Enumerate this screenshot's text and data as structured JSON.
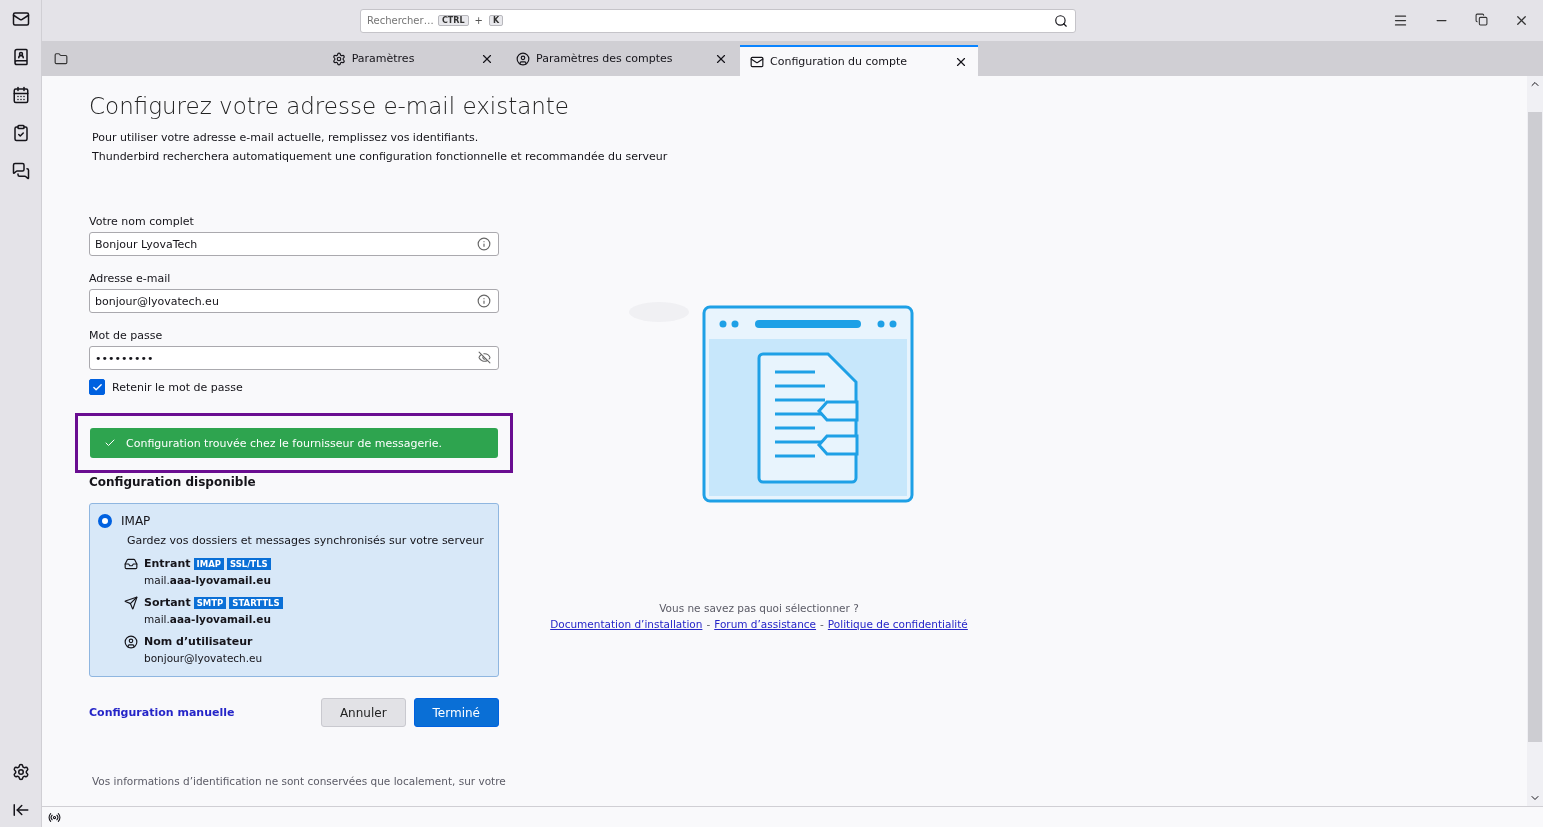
{
  "search": {
    "placeholder": "Rechercher…",
    "keys": [
      "CTRL",
      "+",
      "K"
    ]
  },
  "tabs": [
    {
      "label": "Paramètres",
      "kind": "gear",
      "selected": false
    },
    {
      "label": "Paramètres des comptes",
      "kind": "account",
      "selected": false
    },
    {
      "label": "Configuration du compte",
      "kind": "mail",
      "selected": true
    }
  ],
  "heading": "Configurez votre adresse e-mail existante",
  "intro": [
    "Pour utiliser votre adresse e-mail actuelle, remplissez vos identifiants.",
    "Thunderbird recherchera automatiquement une configuration fonctionnelle et recommandée du serveur"
  ],
  "fields": [
    {
      "label": "Votre nom complet",
      "value": "Bonjour LyovaTech",
      "kind": "info"
    },
    {
      "label": "Adresse e-mail",
      "value": "bonjour@lyovatech.eu",
      "kind": "info"
    },
    {
      "label": "Mot de passe",
      "value": "•••••••••",
      "kind": "password"
    }
  ],
  "remember": {
    "label": "Retenir le mot de passe",
    "checked": true
  },
  "notice": {
    "text": "Configuration trouvée chez le fournisseur de messagerie.",
    "highlighted": true
  },
  "config": {
    "title": "Configuration disponible",
    "options": [
      {
        "label": "IMAP",
        "selected": true,
        "description": "Gardez vos dossiers et messages synchronisés sur votre serveur",
        "entries": [
          {
            "kind": "incoming",
            "label": "Entrant",
            "tags": [
              "IMAP",
              "SSL/TLS"
            ],
            "value": "mail.**aaa-lyovamail.eu**"
          },
          {
            "kind": "outgoing",
            "label": "Sortant",
            "tags": [
              "SMTP",
              "STARTTLS"
            ],
            "value": "mail.**aaa-lyovamail.eu**"
          },
          {
            "kind": "user",
            "label": "Nom d’utilisateur",
            "value": "bonjour@lyovatech.eu"
          }
        ]
      }
    ]
  },
  "actions": {
    "manual": "Configuration manuelle",
    "cancel": "Annuler",
    "done": "Terminé"
  },
  "footnote": "Vos informations d’identification ne sont conservées que localement, sur votre",
  "help": {
    "question": "Vous ne savez pas quoi sélectionner ?",
    "links": [
      "Documentation d’installation",
      "Forum d’assistance",
      "Politique de confidentialité"
    ],
    "separator": "-"
  }
}
